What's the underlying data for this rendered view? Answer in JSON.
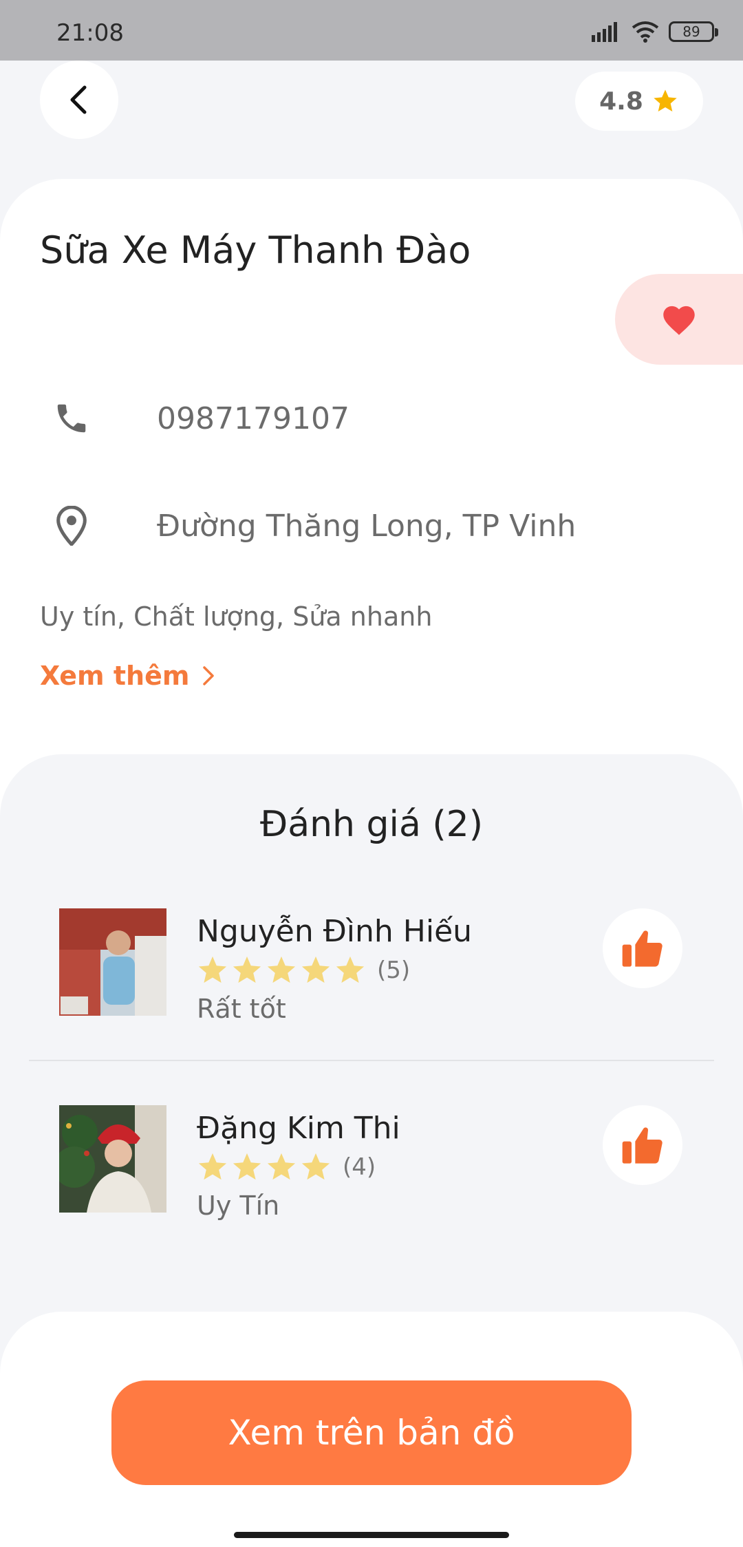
{
  "status_bar": {
    "time": "21:08",
    "battery": "89"
  },
  "header": {
    "rating": "4.8"
  },
  "shop": {
    "name": "Sữa Xe Máy Thanh Đào",
    "phone": "0987179107",
    "address": "Đường Thăng Long, TP Vinh",
    "description": "Uy tín, Chất lượng, Sửa nhanh",
    "more_label": "Xem thêm"
  },
  "reviews": {
    "title": "Đánh giá (2)",
    "items": [
      {
        "name": "Nguyễn Đình Hiếu",
        "stars": 5,
        "count": "(5)",
        "comment": "Rất tốt"
      },
      {
        "name": "Đặng Kim Thi",
        "stars": 4,
        "count": "(4)",
        "comment": "Uy Tín"
      }
    ]
  },
  "map_button": {
    "label": "Xem trên bản đồ"
  },
  "colors": {
    "accent": "#ff7a42",
    "star": "#f5d77a",
    "heart": "#f24b4b",
    "rating_star": "#f7b500"
  }
}
